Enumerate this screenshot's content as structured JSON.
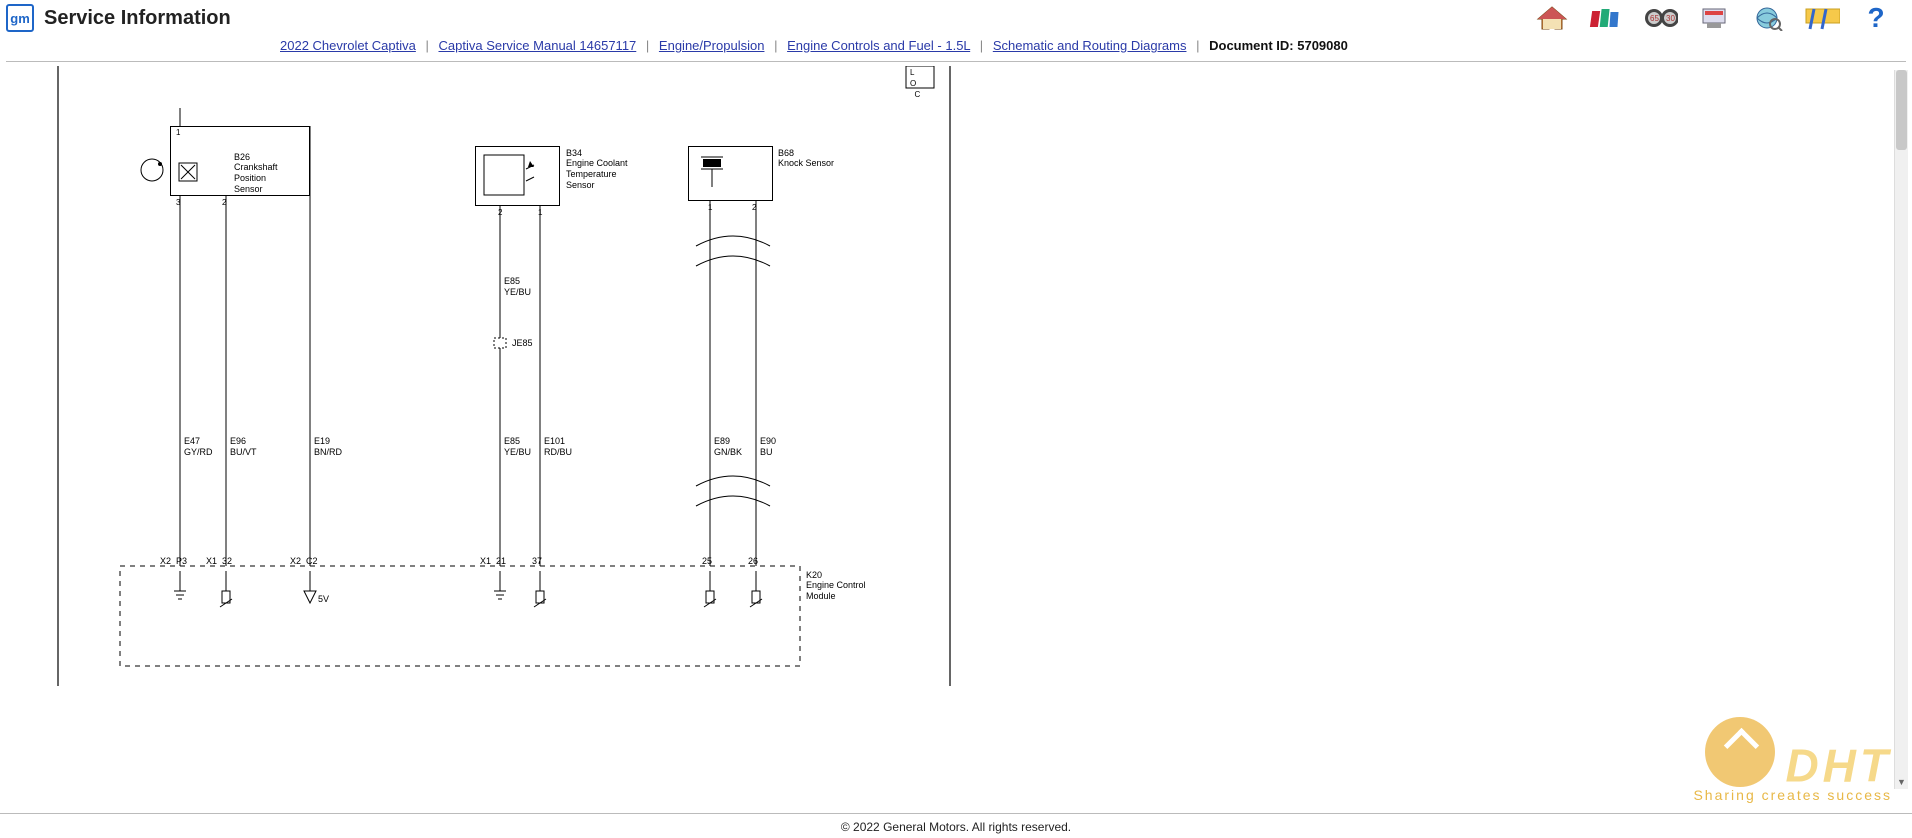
{
  "header": {
    "title": "Service Information",
    "logo_text": "gm"
  },
  "toolbar": {
    "home_tip": "Home",
    "books_tip": "Publications",
    "binoculars_tip": "Search",
    "tools_tip": "Tools",
    "globe_tip": "SI Index",
    "tsb_tip": "TSB",
    "help_label": "?"
  },
  "breadcrumb": {
    "vehicle": "2022 Chevrolet Captiva",
    "manual": "Captiva Service Manual 14657117",
    "section": "Engine/Propulsion",
    "subsection": "Engine Controls and Fuel - 1.5L",
    "docgroup": "Schematic and Routing Diagrams",
    "docid_label": "Document ID:",
    "docid_value": "5709080"
  },
  "diagram": {
    "upper_right_box": "L\nO\n  C",
    "sensors": {
      "b26": {
        "id": "B26",
        "name": "Crankshaft\nPosition\nSensor",
        "pins_top": [
          "1"
        ],
        "pins_bottom": [
          "3",
          "2"
        ]
      },
      "b34": {
        "id": "B34",
        "name": "Engine Coolant\nTemperature\nSensor",
        "pins_bottom": [
          "2",
          "1"
        ]
      },
      "b68": {
        "id": "B68",
        "name": "Knock Sensor",
        "pins_bottom": [
          "1",
          "2"
        ]
      }
    },
    "wires": {
      "e47": "E47\nGY/RD",
      "e96": "E96\nBU/VT",
      "e19": "E19\nBN/RD",
      "e85a": "E85\nYE/BU",
      "je85": "JE85",
      "e85b": "E85\nYE/BU",
      "e101": "E101\nRD/BU",
      "e89": "E89\nGN/BK",
      "e90": "E90\nBU"
    },
    "ecm_pins": {
      "p1": "X2  P3",
      "p2": "X1  32",
      "p3": "X2  C2",
      "p4": "X1  21",
      "p5": "37",
      "p6": "25",
      "p7": "26"
    },
    "ecm_label_id": "K20",
    "ecm_label_name": "Engine Control\nModule",
    "volt_label": "5V"
  },
  "footer": {
    "copyright": "© 2022 General Motors.  All rights reserved."
  },
  "watermark": {
    "title": "DHT",
    "sub": "Sharing creates success"
  }
}
